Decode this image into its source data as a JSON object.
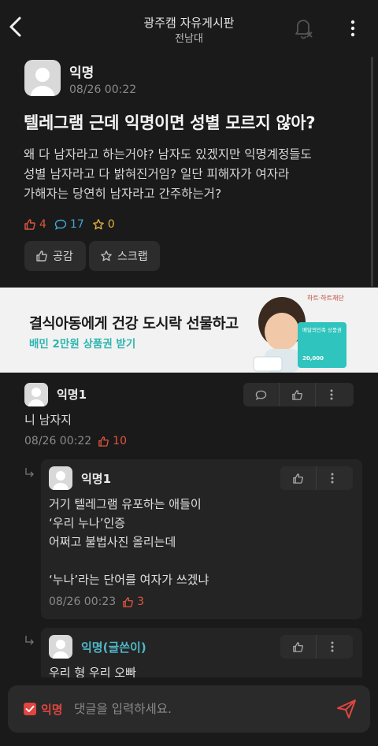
{
  "header": {
    "title": "광주캠 자유게시판",
    "subtitle": "전남대"
  },
  "post": {
    "author": "익명",
    "time": "08/26 00:22",
    "title": "텔레그램 근데 익명이면 성별 모르지 않아?",
    "body_lines": [
      "왜 다 남자라고 하는거야? 남자도 있겠지만 익명계정들도",
      "성별 남자라고 다 밝혀진거임? 일단 피해자가 여자라",
      "가해자는 당연히 남자라고 간주하는거?"
    ],
    "likes": "4",
    "comments": "17",
    "scraps": "0",
    "like_button": "공감",
    "scrap_button": "스크랩"
  },
  "ad": {
    "title": "결식아동에게 건강 도시락 선물하고",
    "subtitle": "배민 2만원 상품권 받기",
    "brand": "하트·하트재단",
    "card_label": "배달의민족 상품권",
    "card_amount": "20,000"
  },
  "comments": [
    {
      "author": "익명1",
      "lines": [
        "니 남자지"
      ],
      "time": "08/26 00:22",
      "likes": "10"
    }
  ],
  "replies": [
    {
      "author": "익명1",
      "lines": [
        "거기 텔레그램 유포하는 애들이",
        "‘우리 누나’인증",
        "어쩌고 불법사진 올리는데",
        "",
        "‘누나’라는 단어를 여자가 쓰겠냐"
      ],
      "time": "08/26 00:23",
      "likes": "3"
    },
    {
      "author": "익명(글쓴이)",
      "lines": [
        "우리 형 우리 오빠"
      ]
    }
  ],
  "input": {
    "anon_label": "익명",
    "placeholder": "댓글을 입력하세요."
  },
  "colors": {
    "background": "#1a1a1a",
    "like": "#e0553f",
    "comment": "#3fa7d6",
    "scrap": "#e0b23f",
    "op_author": "#4fb8c8"
  }
}
